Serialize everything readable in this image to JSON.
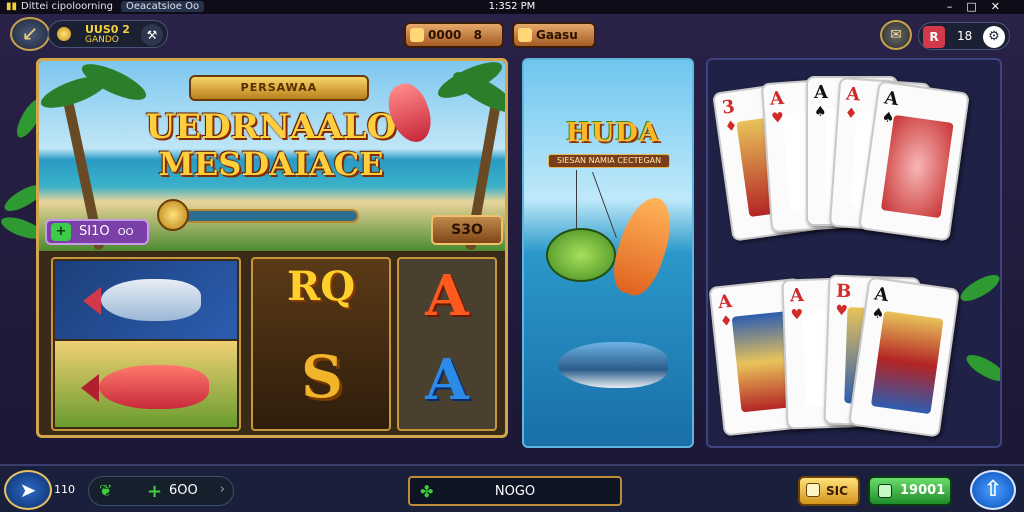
{
  "status_bar": {
    "app_name": "Dittei cipoloorning",
    "app_tag": "Oeacatsioe Oo",
    "time": "1:3S2 PM"
  },
  "top_bar": {
    "profile_line1": "UUS0 2",
    "profile_line2": "GANDO",
    "coins_value": "0000",
    "coins_suffix": "8",
    "gift_label": "Gaasu",
    "right_badge": "R",
    "right_value": "18"
  },
  "slot_game": {
    "banner": "PERSAWAA",
    "title_line1": "UEDRNAALO",
    "title_line2": "MESDAIACE",
    "bet_value": "SI1O",
    "bet_suffix": "OO",
    "spin_value": "S3O",
    "reel_symbols": [
      "RQ",
      "S",
      "A",
      "A"
    ]
  },
  "fishing_game": {
    "logo": "HUDA",
    "subtitle": "SIESAN NAMIA CECTEGAN"
  },
  "cards_game": {
    "cards_back": [
      {
        "rank": "3",
        "suit": "♦",
        "color": "red"
      },
      {
        "rank": "A",
        "suit": "♥",
        "color": "red"
      },
      {
        "rank": "A",
        "suit": "♠",
        "color": "blk"
      },
      {
        "rank": "A",
        "suit": "♦",
        "color": "red"
      },
      {
        "rank": "A",
        "suit": "♠",
        "color": "blk"
      }
    ],
    "cards_front": [
      {
        "rank": "A",
        "suit": "♦",
        "color": "red"
      },
      {
        "rank": "A",
        "suit": "♥",
        "color": "red"
      },
      {
        "rank": "B",
        "suit": "♥",
        "color": "red"
      },
      {
        "rank": "A",
        "suit": "♠",
        "color": "blk"
      }
    ]
  },
  "bottom_bar": {
    "level": "110",
    "green_value": "6OO",
    "center_text": "NOGO",
    "gold_button": "SIC",
    "green_button": "19001"
  }
}
